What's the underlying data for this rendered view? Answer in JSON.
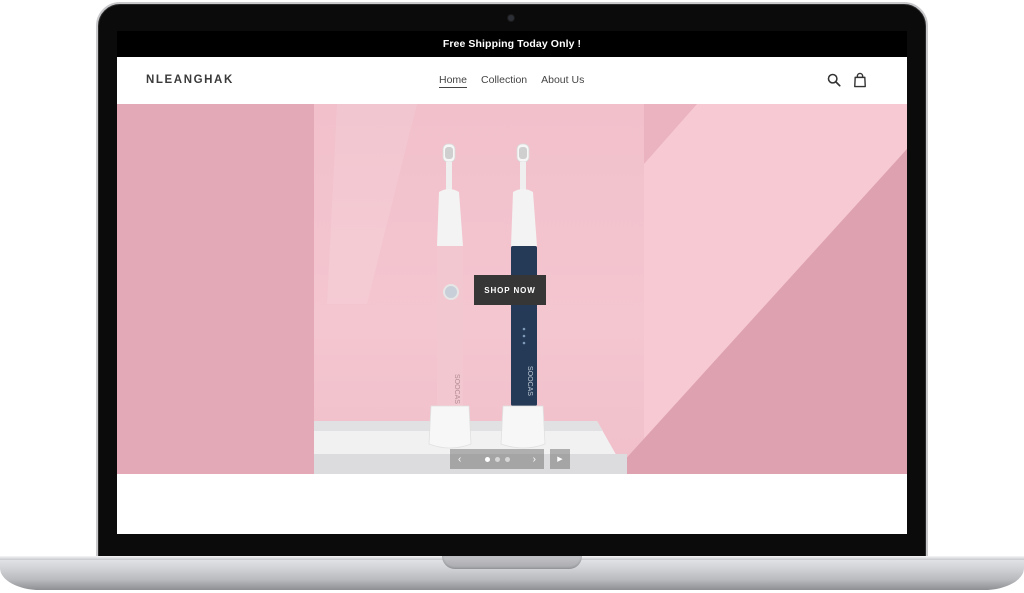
{
  "announcement": {
    "text": "Free Shipping Today Only !"
  },
  "header": {
    "logo": "NLEANGHAK",
    "nav": [
      {
        "label": "Home",
        "active": true
      },
      {
        "label": "Collection",
        "active": false
      },
      {
        "label": "About Us",
        "active": false
      }
    ],
    "icons": [
      "search-icon",
      "cart-icon"
    ]
  },
  "hero": {
    "cta_label": "SHOP NOW",
    "product_brand": "SOOCAS",
    "slides_total": 3,
    "active_slide": 1,
    "prev_label": "‹",
    "next_label": "›",
    "play_label": "▶"
  },
  "colors": {
    "announcement_bg": "#000000",
    "hero_pink": "#e3a6b5",
    "hero_light_pink": "#f6c9d3",
    "cta_bg": "#363636",
    "brush_pink": "#f3c7cf",
    "brush_navy": "#243a57"
  }
}
